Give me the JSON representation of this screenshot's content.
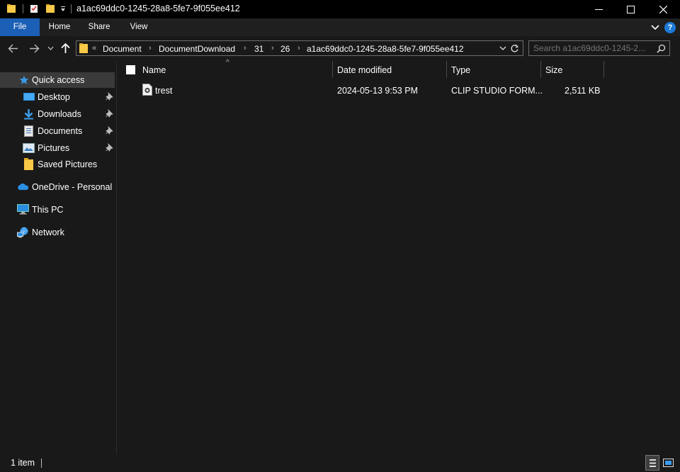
{
  "window": {
    "title": "a1ac69ddc0-1245-28a8-5fe7-9f055ee412",
    "controls": {
      "minimize": "—",
      "maximize": "☐",
      "close": "✕"
    }
  },
  "ribbon": {
    "tabs": [
      "File",
      "Home",
      "Share",
      "View"
    ],
    "help_label": "?"
  },
  "address_bar": {
    "overflow": "«",
    "crumbs": [
      "Document",
      "DocumentDownload",
      "31",
      "26",
      "a1ac69ddc0-1245-28a8-5fe7-9f055ee412"
    ]
  },
  "search": {
    "placeholder": "Search a1ac69ddc0-1245-2..."
  },
  "sidebar": {
    "quick_access": "Quick access",
    "items": [
      {
        "label": "Desktop",
        "icon": "desktop-icon",
        "pinned": true
      },
      {
        "label": "Downloads",
        "icon": "downloads-icon",
        "pinned": true
      },
      {
        "label": "Documents",
        "icon": "documents-icon",
        "pinned": true
      },
      {
        "label": "Pictures",
        "icon": "pictures-icon",
        "pinned": true
      },
      {
        "label": "Saved Pictures",
        "icon": "folder-icon",
        "pinned": false
      }
    ],
    "onedrive": "OneDrive - Personal",
    "this_pc": "This PC",
    "network": "Network"
  },
  "file_list": {
    "columns": {
      "name": "Name",
      "date": "Date modified",
      "type": "Type",
      "size": "Size"
    },
    "sort_indicator": "^",
    "rows": [
      {
        "name": "trest",
        "date": "2024-05-13 9:53 PM",
        "type": "CLIP STUDIO FORM...",
        "size": "2,511 KB"
      }
    ]
  },
  "status_bar": {
    "count": "1 item"
  },
  "colors": {
    "background": "#191919",
    "accent": "#1b5fb6",
    "folder": "#f8c847",
    "selection": "#3a3a3a"
  }
}
